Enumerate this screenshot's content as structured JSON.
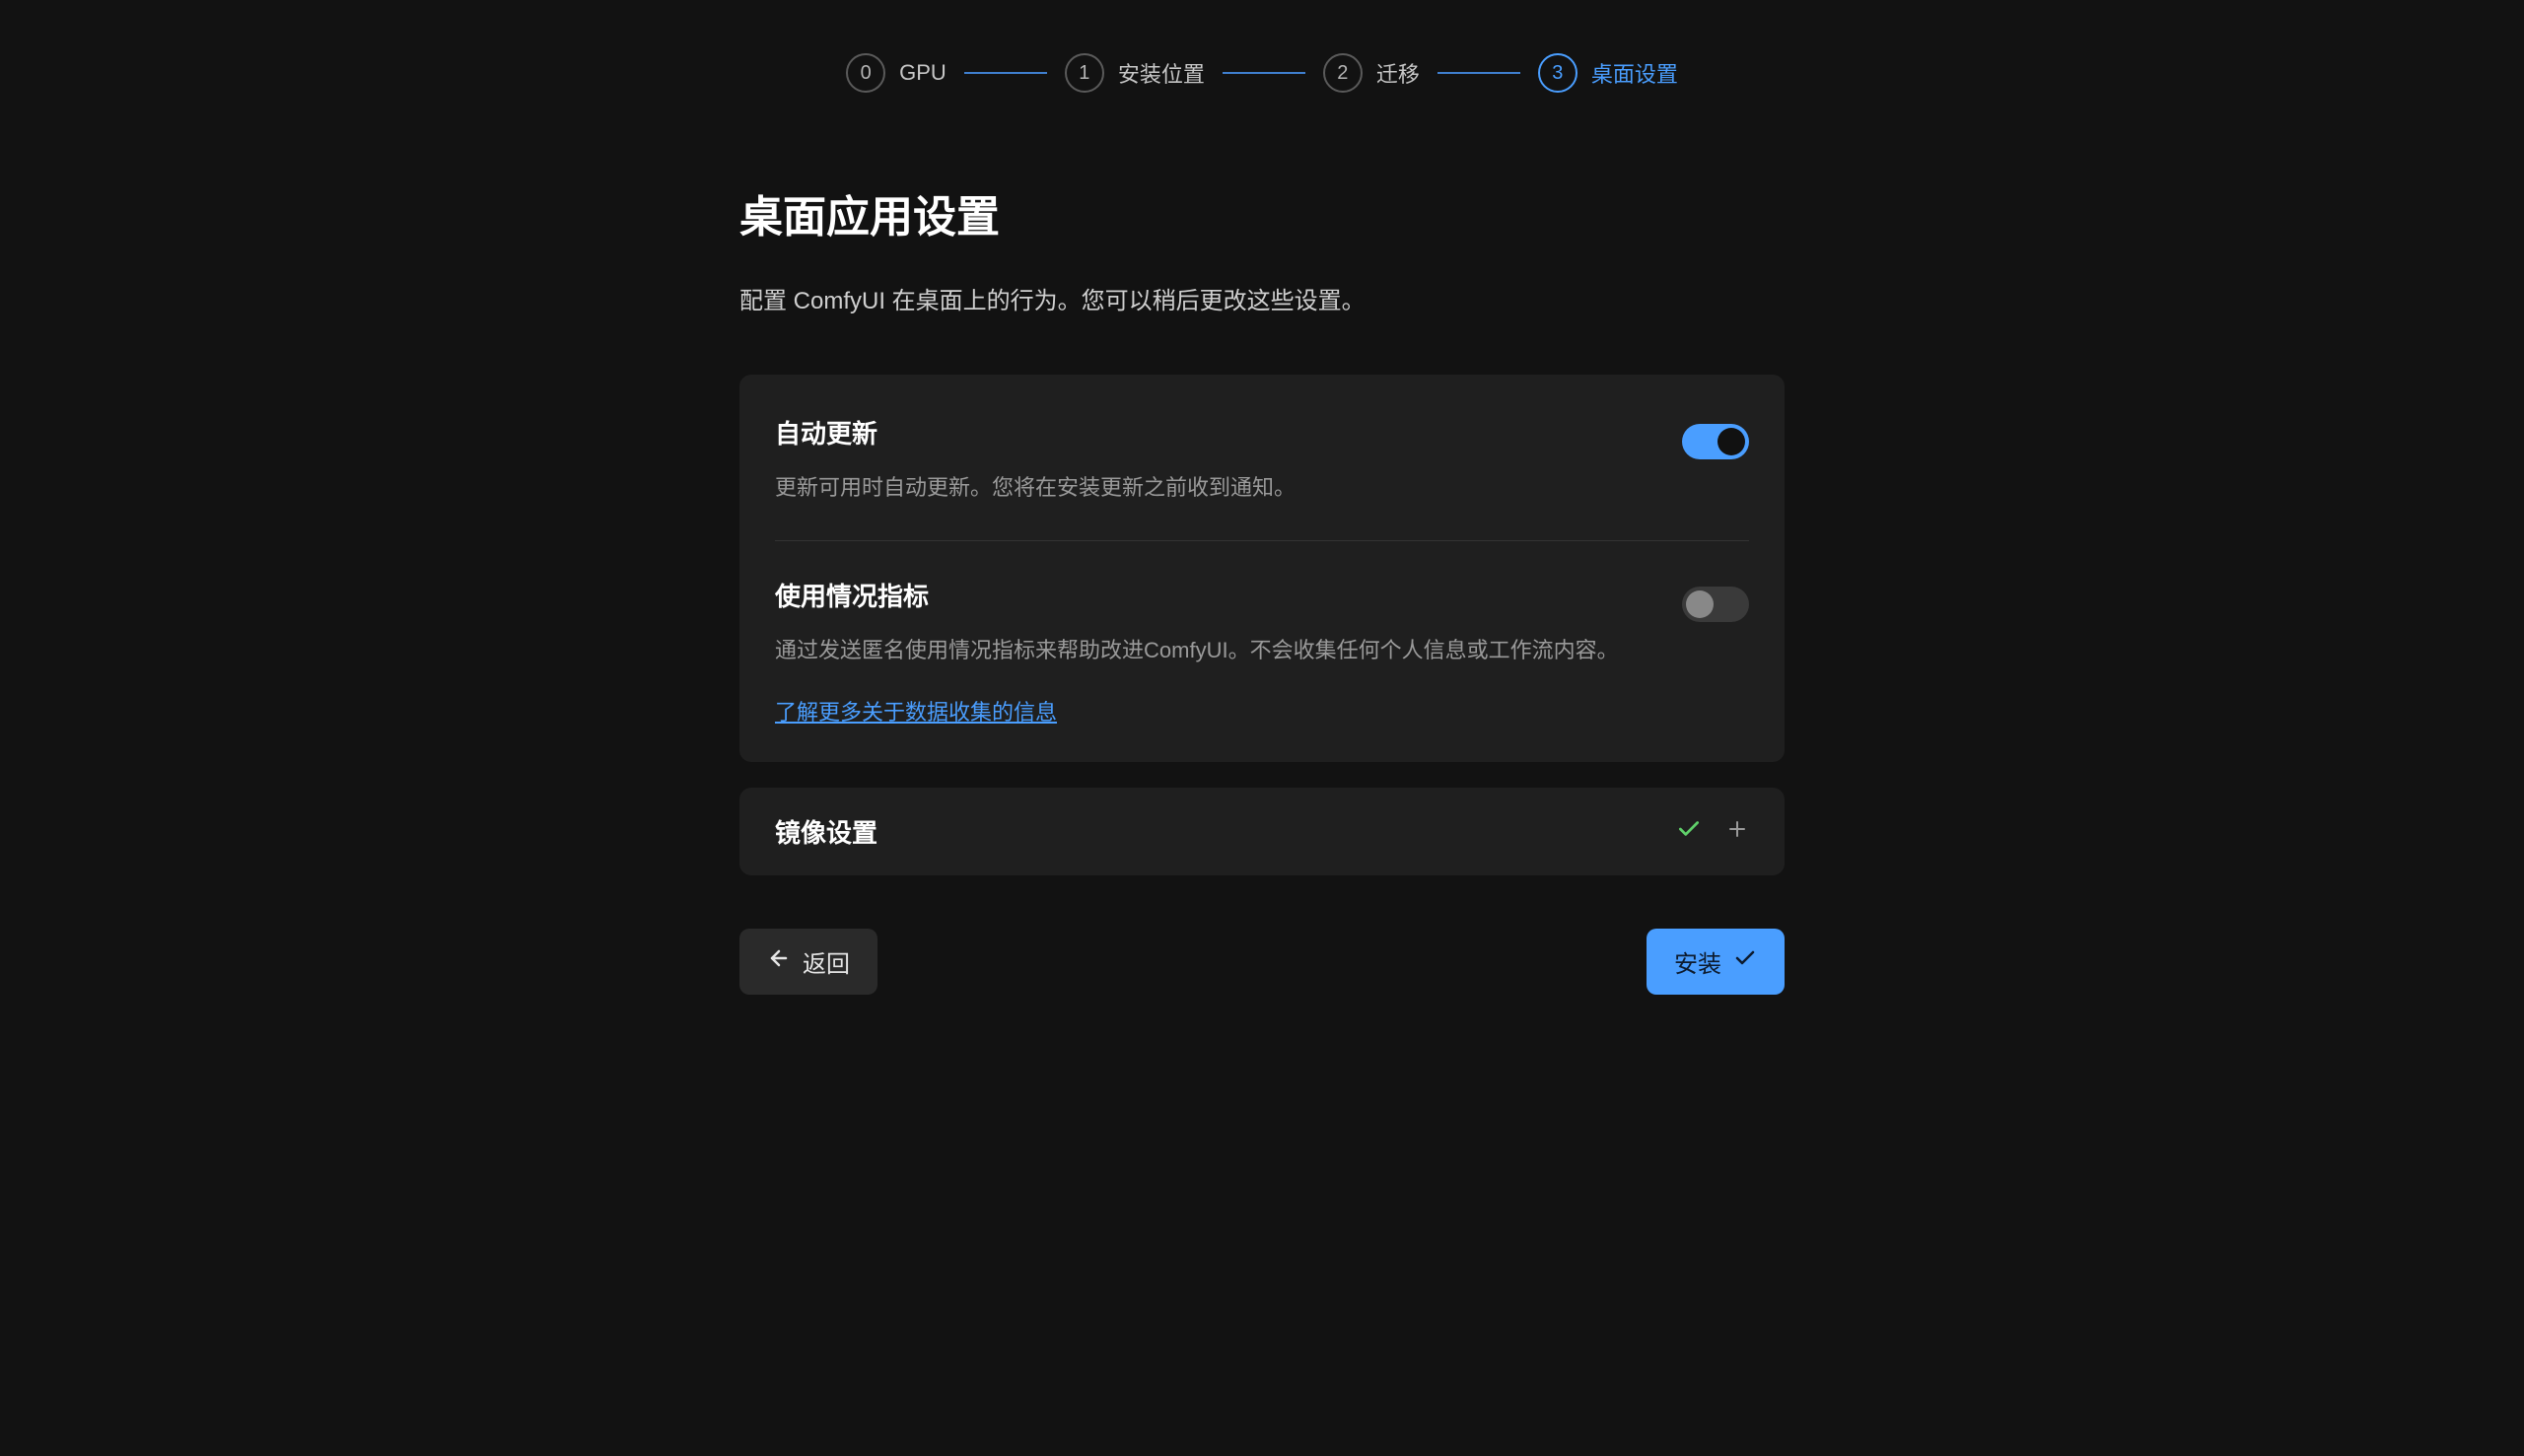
{
  "stepper": {
    "steps": [
      {
        "num": "0",
        "label": "GPU",
        "active": false
      },
      {
        "num": "1",
        "label": "安装位置",
        "active": false
      },
      {
        "num": "2",
        "label": "迁移",
        "active": false
      },
      {
        "num": "3",
        "label": "桌面设置",
        "active": true
      }
    ]
  },
  "page": {
    "title": "桌面应用设置",
    "description": "配置 ComfyUI 在桌面上的行为。您可以稍后更改这些设置。"
  },
  "settings": {
    "auto_update": {
      "title": "自动更新",
      "description": "更新可用时自动更新。您将在安装更新之前收到通知。",
      "enabled": true
    },
    "usage_metrics": {
      "title": "使用情况指标",
      "description": "通过发送匿名使用情况指标来帮助改进ComfyUI。不会收集任何个人信息或工作流内容。",
      "enabled": false,
      "link_text": "了解更多关于数据收集的信息"
    }
  },
  "accordion": {
    "mirror_settings": {
      "title": "镜像设置"
    }
  },
  "footer": {
    "back_label": "返回",
    "install_label": "安装"
  }
}
